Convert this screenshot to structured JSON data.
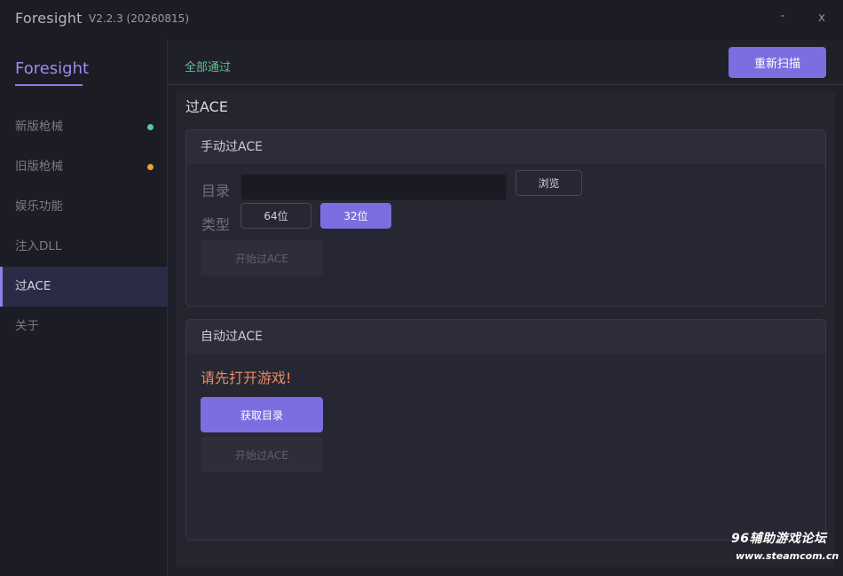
{
  "window": {
    "app_name": "Foresight",
    "version": "V2.2.3 (20260815)",
    "minimize": "-",
    "close": "x"
  },
  "sidebar": {
    "brand": "Foresight",
    "items": [
      {
        "label": "新版枪械",
        "dot_color": "#4fd1a0"
      },
      {
        "label": "旧版枪械",
        "dot_color": "#f0a030"
      },
      {
        "label": "娱乐功能"
      },
      {
        "label": "注入DLL"
      },
      {
        "label": "过ACE",
        "active": true
      },
      {
        "label": "关于"
      }
    ]
  },
  "topbar": {
    "status": "全部通过",
    "rescan_button": "重新扫描"
  },
  "page": {
    "title": "过ACE",
    "manual": {
      "header": "手动过ACE",
      "dir_label": "目录",
      "dir_value": "",
      "browse_button": "浏览",
      "type_label": "类型",
      "type_64": "64位",
      "type_32": "32位",
      "start_button": "开始过ACE"
    },
    "auto": {
      "header": "自动过ACE",
      "warning": "请先打开游戏!",
      "get_dir_button": "获取目录",
      "start_button": "开始过ACE"
    }
  },
  "watermark": {
    "site_name": "96辅助游戏论坛",
    "url": "www.steamcom.cn"
  },
  "colors": {
    "accent": "#7c6ee0",
    "success": "#5cc494",
    "warning": "#e88a60"
  }
}
